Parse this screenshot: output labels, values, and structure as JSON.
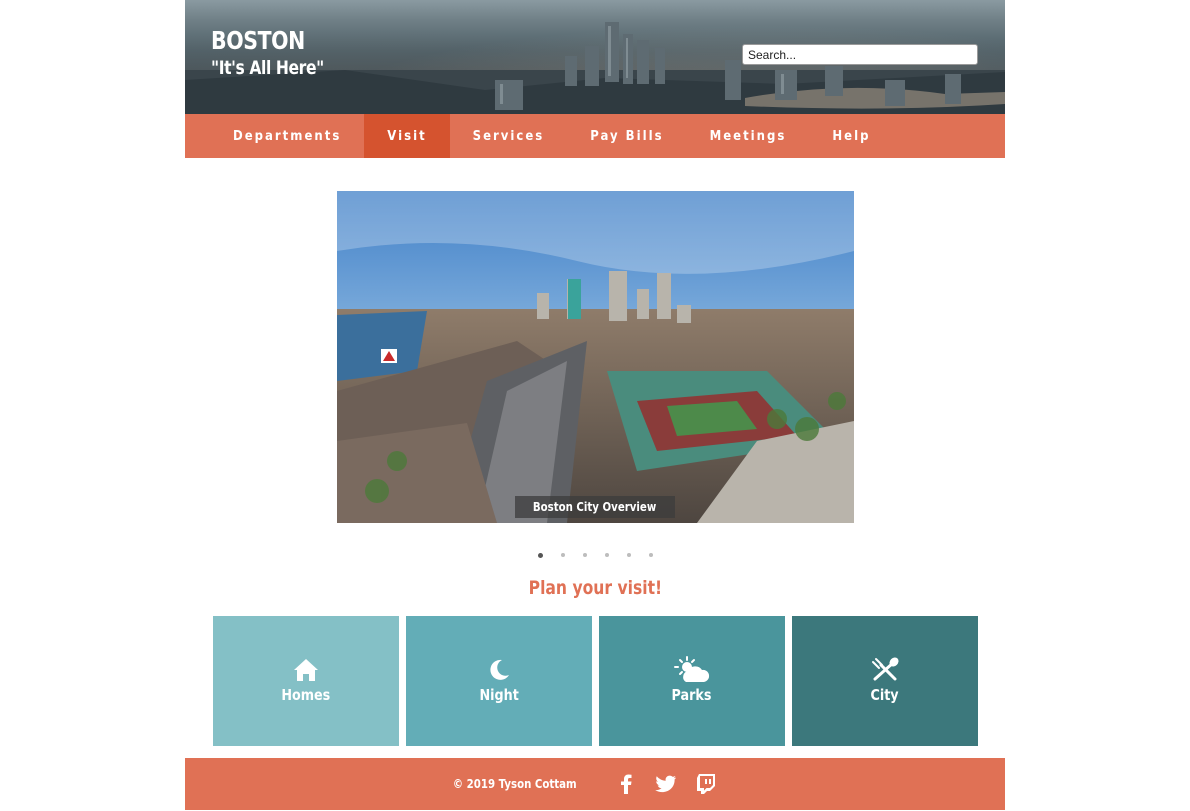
{
  "header": {
    "brand": "BOSTON",
    "tagline": "\"It's All Here\"",
    "search_placeholder": "Search..."
  },
  "nav": {
    "items": [
      {
        "label": "Departments",
        "active": false
      },
      {
        "label": "Visit",
        "active": true
      },
      {
        "label": "Services",
        "active": false
      },
      {
        "label": "Pay Bills",
        "active": false
      },
      {
        "label": "Meetings",
        "active": false
      },
      {
        "label": "Help",
        "active": false
      }
    ]
  },
  "carousel": {
    "caption": "Boston City Overview",
    "slide_count": 6,
    "active_index": 0
  },
  "plan": {
    "heading": "Plan your visit!",
    "tiles": [
      {
        "label": "Homes",
        "icon": "home-icon",
        "color": "#84c0c6"
      },
      {
        "label": "Night",
        "icon": "moon-icon",
        "color": "#63adb7"
      },
      {
        "label": "Parks",
        "icon": "partly-cloudy-icon",
        "color": "#4a959c"
      },
      {
        "label": "City",
        "icon": "fork-spoon-icon",
        "color": "#3c787c"
      }
    ]
  },
  "footer": {
    "copyright": "© 2019 Tyson Cottam",
    "social": [
      "facebook-icon",
      "twitter-icon",
      "twitch-icon"
    ]
  },
  "colors": {
    "accent": "#e07155",
    "accent_active": "#d5532f"
  }
}
